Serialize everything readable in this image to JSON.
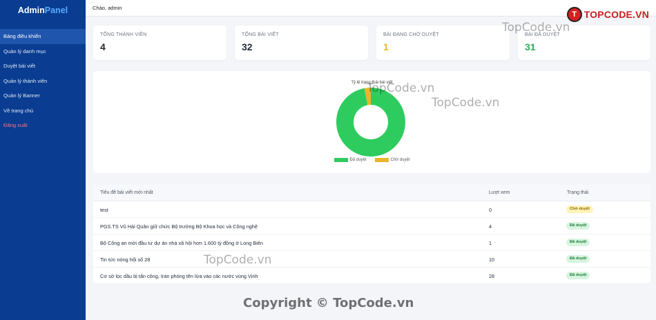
{
  "brand": {
    "part1": "Admin",
    "part2": "Panel"
  },
  "sidebar": {
    "items": [
      {
        "label": "Bảng điều khiển"
      },
      {
        "label": "Quản lý danh mục"
      },
      {
        "label": "Duyệt bài viết"
      },
      {
        "label": "Quản lý thành viên"
      },
      {
        "label": "Quản lý Banner"
      },
      {
        "label": "Về trang chủ"
      },
      {
        "label": "Đăng xuất"
      }
    ]
  },
  "header": {
    "greeting": "Chào, admin"
  },
  "logo": {
    "badge": "T",
    "text": "TOPCODE.VN"
  },
  "stats": [
    {
      "label": "TỔNG THÀNH VIÊN",
      "value": "4"
    },
    {
      "label": "TỔNG BÀI VIẾT",
      "value": "32"
    },
    {
      "label": "BÀI ĐANG CHỜ DUYỆT",
      "value": "1"
    },
    {
      "label": "BÀI ĐÃ DUYỆT",
      "value": "31"
    }
  ],
  "chart_data": {
    "type": "pie",
    "title": "Tỷ lệ trạng thái bài viết",
    "categories": [
      "Đã duyệt",
      "Chờ duyệt"
    ],
    "values": [
      31,
      1
    ],
    "colors": [
      "#2ecc5f",
      "#e8b52c"
    ],
    "donut": true,
    "legend": "bottom"
  },
  "table": {
    "headers": {
      "title": "Tiêu đề bài viết mới nhất",
      "views": "Lượt xem",
      "status": "Trạng thái"
    },
    "rows": [
      {
        "title": "test",
        "views": "0",
        "status": "Chờ duyệt",
        "kind": "pending"
      },
      {
        "title": "PGS.TS Vũ Hải Quân giữ chức Bộ trưởng Bộ Khoa học và Công nghệ",
        "views": "4",
        "status": "Đã duyệt",
        "kind": "approved"
      },
      {
        "title": "Bộ Công an mời đầu tư dự án nhà xã hội hơn 1.600 tỷ đồng ở Long Biên",
        "views": "1",
        "status": "Đã duyệt",
        "kind": "approved"
      },
      {
        "title": "Tin tức nóng hổi số 28",
        "views": "10",
        "status": "Đã duyệt",
        "kind": "approved"
      },
      {
        "title": "Cơ sở lọc dầu bị tấn công, Iran phóng tên lửa vào các nước vùng Vịnh",
        "views": "28",
        "status": "Đã duyệt",
        "kind": "approved"
      }
    ]
  },
  "watermarks": {
    "site": "TopCode.vn",
    "copyright": "Copyright © TopCode.vn"
  }
}
